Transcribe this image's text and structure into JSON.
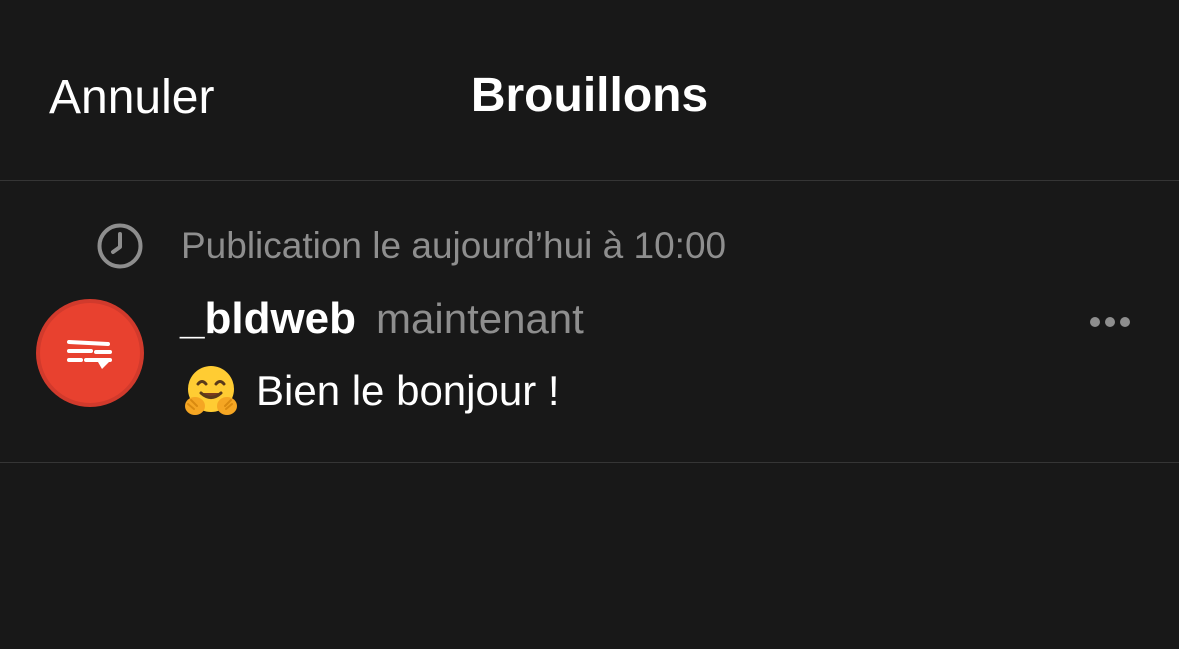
{
  "header": {
    "cancel_label": "Annuler",
    "title": "Brouillons"
  },
  "draft": {
    "schedule_icon": "clock-icon",
    "schedule_text": "Publication le aujourd’hui à 10:00",
    "author": "_bldweb",
    "timestamp": "maintenant",
    "emoji": "🤗",
    "text": "Bien le bonjour !",
    "more_icon": "ellipsis-icon",
    "avatar_color": "#e8412f"
  },
  "colors": {
    "background": "#181818",
    "secondary_text": "#8e8e8e",
    "divider": "#353535"
  }
}
